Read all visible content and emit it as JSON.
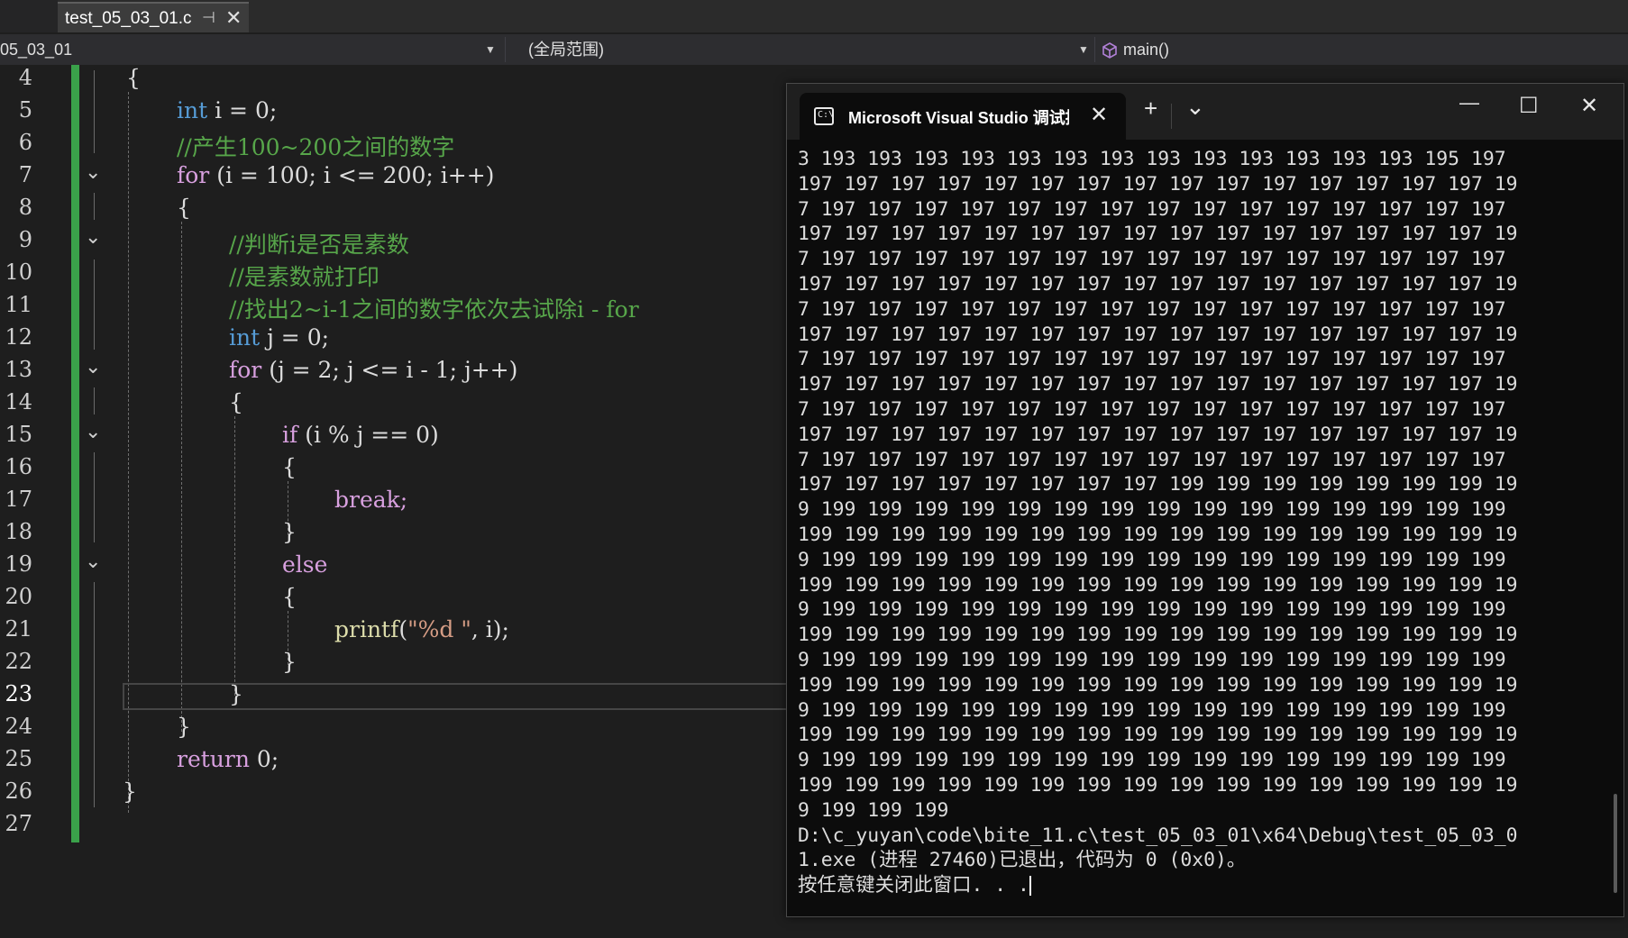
{
  "tabbar": {
    "active_file": "test_05_03_01.c",
    "pin_glyph": "⊣",
    "close_glyph": "✕"
  },
  "navbar": {
    "project": "05_03_01",
    "scope": "(全局范围)",
    "function": "main()"
  },
  "editor": {
    "line_numbers": [
      "4",
      "5",
      "6",
      "7",
      "8",
      "9",
      "10",
      "11",
      "12",
      "13",
      "14",
      "15",
      "16",
      "17",
      "18",
      "19",
      "20",
      "21",
      "22",
      "23",
      "24",
      "25",
      "26",
      "27"
    ],
    "current_line": "23",
    "code": {
      "l4": "{",
      "l5_kw": "int",
      "l5_rest": " i = 0;",
      "l6": "//产生100~200之间的数字",
      "l7_kw": "for",
      "l7_rest": " (i = 100; i <= 200; i++)",
      "l8": "{",
      "l9": "//判断i是否是素数",
      "l10": "//是素数就打印",
      "l11": "//找出2~i-1之间的数字依次去试除i - for",
      "l12_kw": "int",
      "l12_rest": " j = 0;",
      "l13_kw": "for",
      "l13_rest": " (j = 2; j <= i - 1; j++)",
      "l14": "{",
      "l15_kw": "if",
      "l15_rest": " (i % j == 0)",
      "l16": "{",
      "l17": "break;",
      "l18": "}",
      "l19": "else",
      "l20": "{",
      "l21_fn": "printf",
      "l21_open": "(",
      "l21_str": "\"%d \"",
      "l21_rest": ", i);",
      "l22": "}",
      "l23": "}",
      "l24": "}",
      "l25_kw": "return",
      "l25_rest": " 0;",
      "l26": "}"
    }
  },
  "console": {
    "title": "Microsoft Visual Studio 调试控制台",
    "add_glyph": "+",
    "dropdown_glyph": "⌄",
    "minimize_glyph": "—",
    "maximize_glyph": "☐",
    "close_glyph": "✕",
    "lines": [
      "3 193 193 193 193 193 193 193 193 193 193 193 193 193 195 197",
      "197 197 197 197 197 197 197 197 197 197 197 197 197 197 197 19",
      "7 197 197 197 197 197 197 197 197 197 197 197 197 197 197 197",
      "197 197 197 197 197 197 197 197 197 197 197 197 197 197 197 19",
      "7 197 197 197 197 197 197 197 197 197 197 197 197 197 197 197",
      "197 197 197 197 197 197 197 197 197 197 197 197 197 197 197 19",
      "7 197 197 197 197 197 197 197 197 197 197 197 197 197 197 197",
      "197 197 197 197 197 197 197 197 197 197 197 197 197 197 197 19",
      "7 197 197 197 197 197 197 197 197 197 197 197 197 197 197 197",
      "197 197 197 197 197 197 197 197 197 197 197 197 197 197 197 19",
      "7 197 197 197 197 197 197 197 197 197 197 197 197 197 197 197",
      "197 197 197 197 197 197 197 197 197 197 197 197 197 197 197 19",
      "7 197 197 197 197 197 197 197 197 197 197 197 197 197 197 197",
      "197 197 197 197 197 197 197 197 199 199 199 199 199 199 199 19",
      "9 199 199 199 199 199 199 199 199 199 199 199 199 199 199 199",
      "199 199 199 199 199 199 199 199 199 199 199 199 199 199 199 19",
      "9 199 199 199 199 199 199 199 199 199 199 199 199 199 199 199",
      "199 199 199 199 199 199 199 199 199 199 199 199 199 199 199 19",
      "9 199 199 199 199 199 199 199 199 199 199 199 199 199 199 199",
      "199 199 199 199 199 199 199 199 199 199 199 199 199 199 199 19",
      "9 199 199 199 199 199 199 199 199 199 199 199 199 199 199 199",
      "199 199 199 199 199 199 199 199 199 199 199 199 199 199 199 19",
      "9 199 199 199 199 199 199 199 199 199 199 199 199 199 199 199",
      "199 199 199 199 199 199 199 199 199 199 199 199 199 199 199 19",
      "9 199 199 199 199 199 199 199 199 199 199 199 199 199 199 199",
      "199 199 199 199 199 199 199 199 199 199 199 199 199 199 199 19",
      "9 199 199 199",
      "D:\\c_yuyan\\code\\bite_11.c\\test_05_03_01\\x64\\Debug\\test_05_03_0",
      "1.exe (进程 27460)已退出，代码为 0 (0x0)。",
      "按任意键关闭此窗口. . ."
    ]
  }
}
